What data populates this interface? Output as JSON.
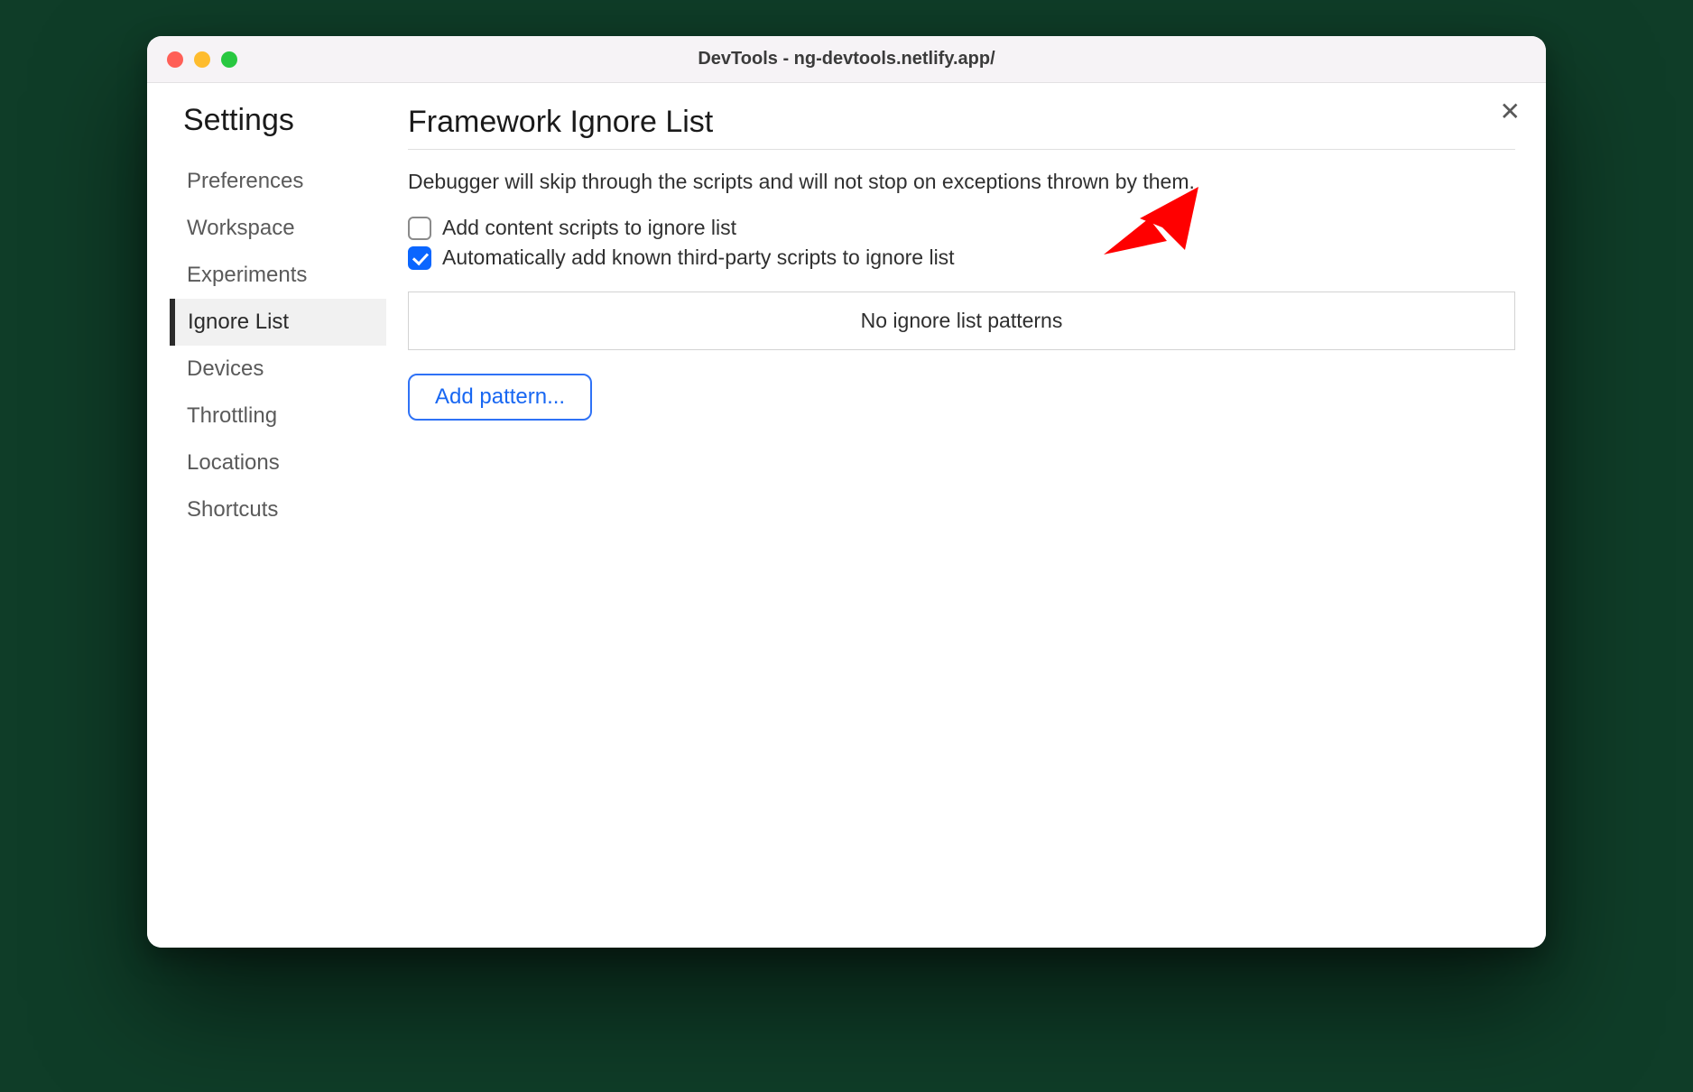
{
  "window": {
    "title": "DevTools - ng-devtools.netlify.app/"
  },
  "close_label": "✕",
  "sidebar": {
    "title": "Settings",
    "items": [
      {
        "label": "Preferences",
        "active": false
      },
      {
        "label": "Workspace",
        "active": false
      },
      {
        "label": "Experiments",
        "active": false
      },
      {
        "label": "Ignore List",
        "active": true
      },
      {
        "label": "Devices",
        "active": false
      },
      {
        "label": "Throttling",
        "active": false
      },
      {
        "label": "Locations",
        "active": false
      },
      {
        "label": "Shortcuts",
        "active": false
      }
    ]
  },
  "panel": {
    "title": "Framework Ignore List",
    "description": "Debugger will skip through the scripts and will not stop on exceptions thrown by them.",
    "checkbox_content_scripts": {
      "label": "Add content scripts to ignore list",
      "checked": false
    },
    "checkbox_third_party": {
      "label": "Automatically add known third-party scripts to ignore list",
      "checked": true
    },
    "patterns_empty": "No ignore list patterns",
    "add_pattern_label": "Add pattern..."
  },
  "annotation": {
    "kind": "red-arrow",
    "color": "#ff0000"
  }
}
